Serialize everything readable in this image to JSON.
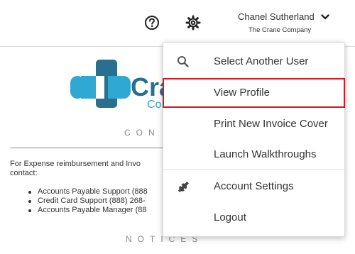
{
  "header": {
    "help_icon": "question-circle-icon",
    "settings_icon": "gear-icon",
    "user": {
      "name": "Chanel Sutherland",
      "company": "The Crane Company",
      "chevron_icon": "chevron-down-icon"
    }
  },
  "logo": {
    "text_partial": "Cra",
    "sub_partial": "Co",
    "colors": {
      "dark": "#2a6f8f",
      "light": "#2fa9d4"
    }
  },
  "content": {
    "contact_heading": "CON",
    "contact_intro_line1": "For Expense reimbursement and Invo",
    "contact_intro_line2": "contact:",
    "contacts": [
      "Accounts Payable Support (888",
      "Credit Card Support (888) 268-",
      "Accounts Payable Manager (88"
    ],
    "notices_heading": "NOTICES"
  },
  "dropdown": {
    "items": [
      {
        "label": "Select Another User",
        "icon": "search-icon"
      },
      {
        "label": "View Profile",
        "icon": "",
        "highlighted": true
      },
      {
        "label": "Print New Invoice Cover",
        "icon": ""
      },
      {
        "label": "Launch Walkthroughs",
        "icon": ""
      },
      {
        "label": "Account Settings",
        "icon": "wrench-icon"
      },
      {
        "label": "Logout",
        "icon": ""
      }
    ],
    "highlight_color": "#e0131f"
  }
}
